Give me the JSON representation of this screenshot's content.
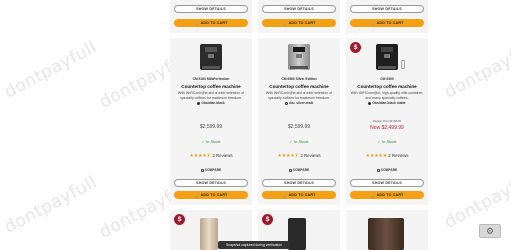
{
  "watermark": "dontpayfull",
  "labels": {
    "show_details": "SHOW DETAILS",
    "add_to_cart": "ADD TO CART",
    "in_stock": "In Stock",
    "compare": "COMPARE"
  },
  "products": [
    {
      "model": "CM 6160 MilkPerfection",
      "title": "Countertop coffee machine",
      "description": "With WiFiConn@ct and a wide selection of specialty coffees for maximum freedom.",
      "color": "Obsidian black",
      "regular_price": "",
      "price": "$2,599.99",
      "on_sale": false,
      "stars": "★★★★⯪",
      "reviews": "2 Reviews"
    },
    {
      "model": "CM 6560 Silver Edition",
      "title": "Countertop coffee machine",
      "description": "With WiFiConn@ct and a wide selection of specialty coffees for maximum freedom.",
      "color": "Alu. silver-matt",
      "regular_price": "",
      "price": "$2,599.99",
      "on_sale": false,
      "stars": "★★★★⯪",
      "reviews": "2 Reviews"
    },
    {
      "model": "CM 6360",
      "title": "Countertop coffee machine",
      "description": "With WiFiConn@ct, high-quality milk container, and many specialty coffees.",
      "color": "Obsidian black matte",
      "regular_price": "Regular Price $2,999.99",
      "price": "Now $2,499.99",
      "on_sale": true,
      "stars": "★★★★★",
      "reviews": "2 Reviews"
    }
  ],
  "sale_badge": "$",
  "toast": "Snapshot captured during verification",
  "colors": {
    "accent": "#f3a012",
    "sale": "#b8213a",
    "badge": "#9e1c2e",
    "stock": "#2b8a3e",
    "card": "#f4f4f4"
  }
}
